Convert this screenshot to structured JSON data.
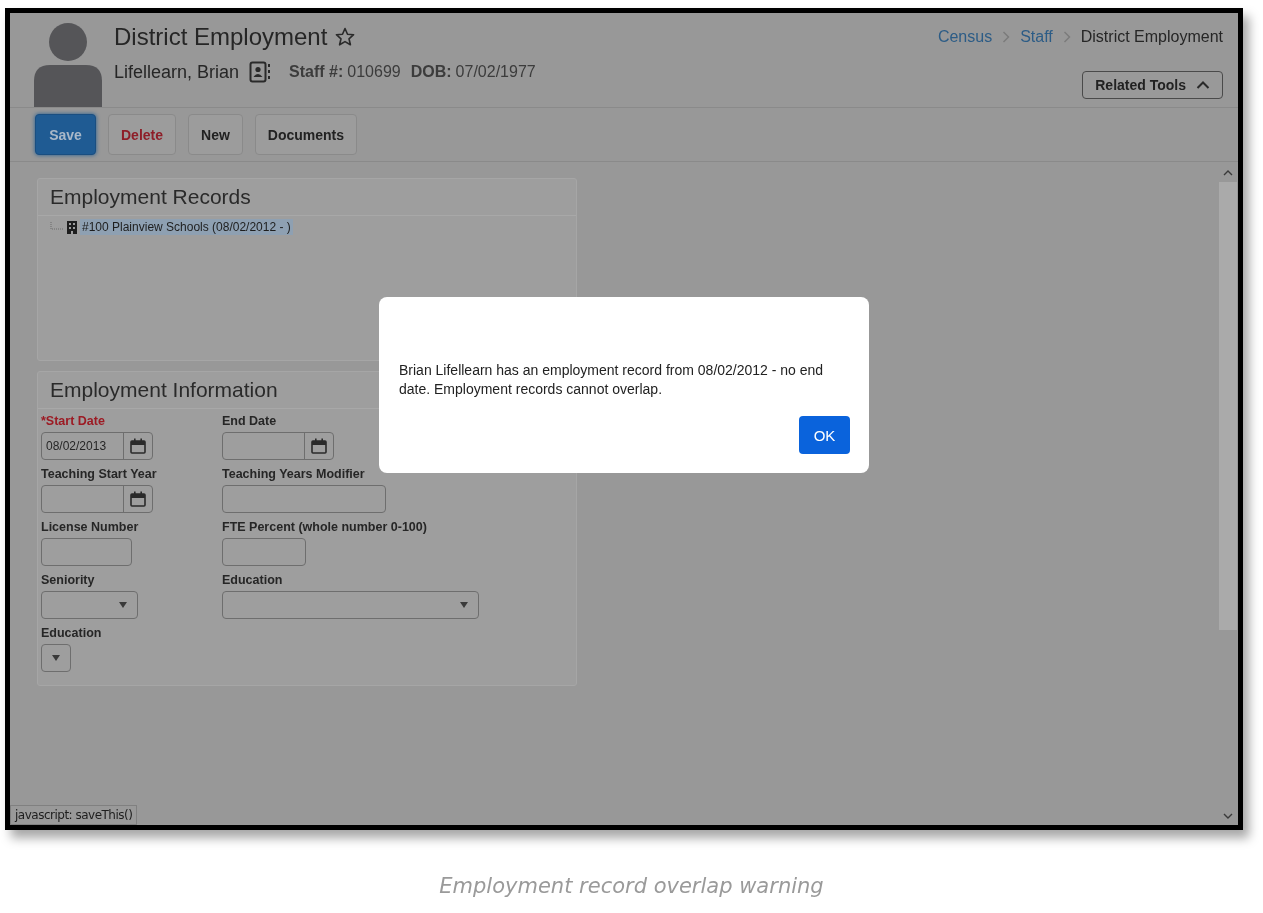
{
  "header": {
    "title": "District Employment",
    "favorite": false,
    "person_name": "Lifellearn, Brian",
    "staff_label": "Staff #:",
    "staff_number": "010699",
    "dob_label": "DOB:",
    "dob": "07/02/1977"
  },
  "breadcrumb": [
    {
      "label": "Census",
      "kind": "link"
    },
    {
      "label": "Staff",
      "kind": "link"
    },
    {
      "label": "District Employment",
      "kind": "current"
    }
  ],
  "related_tools": {
    "label": "Related Tools",
    "expanded": true
  },
  "toolbar": [
    {
      "label": "Save",
      "kind": "primary"
    },
    {
      "label": "Delete",
      "kind": "danger"
    },
    {
      "label": "New",
      "kind": "default"
    },
    {
      "label": "Documents",
      "kind": "default"
    }
  ],
  "records": {
    "title": "Employment Records",
    "items": [
      {
        "label": "#100 Plainview Schools (08/02/2012 - )",
        "selected": true
      }
    ]
  },
  "info": {
    "title": "Employment Information",
    "rows": [
      [
        {
          "label": "*Start Date",
          "required": true,
          "kind": "date",
          "value": "08/02/2013"
        },
        {
          "label": "End Date",
          "required": false,
          "kind": "date"
        }
      ],
      [
        {
          "label": "Teaching Start Year",
          "required": false,
          "kind": "date"
        },
        {
          "label": "Teaching Years Modifier",
          "required": false,
          "kind": "text"
        }
      ],
      [
        {
          "label": "License Number",
          "required": false,
          "kind": "text"
        },
        {
          "label": "FTE Percent (whole number 0-100)",
          "required": false,
          "kind": "text"
        }
      ],
      [
        {
          "label": "Seniority",
          "required": false,
          "kind": "select"
        },
        {
          "label": "Education",
          "required": false,
          "kind": "select"
        }
      ],
      [
        {
          "label": "Education",
          "required": false,
          "kind": "select"
        }
      ]
    ]
  },
  "dialog": {
    "message": "Brian Lifellearn has an employment record from 08/02/2012 - no end date. Employment records cannot overlap.",
    "button": "OK"
  },
  "status_bar": "javascript: saveThis()",
  "caption": "Employment record overlap warning"
}
